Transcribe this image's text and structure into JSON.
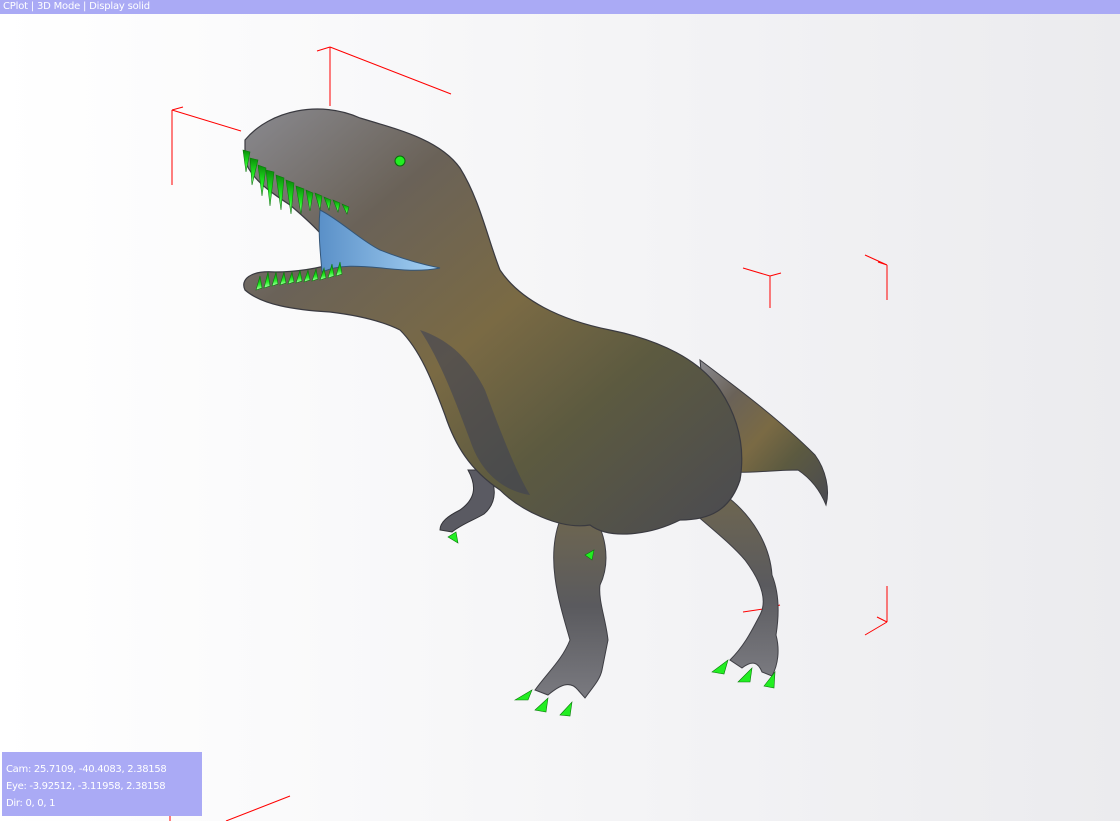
{
  "window": {
    "title": "CPlot | 3D Mode | Display solid"
  },
  "info": {
    "cam": "Cam: 25.7109, -40.4083, 2.38158",
    "eye": "Eye: -3.92512, -3.11958, 2.38158",
    "dir": "Dir: 0, 0, 1"
  },
  "colors": {
    "title_bar": "#aaaaf5",
    "bounding_box": "#ff0000",
    "teeth_claws": "#22ee22",
    "mouth_interior": "#8fc4ee"
  },
  "scene": {
    "model": "t-rex",
    "display_mode": "solid"
  }
}
